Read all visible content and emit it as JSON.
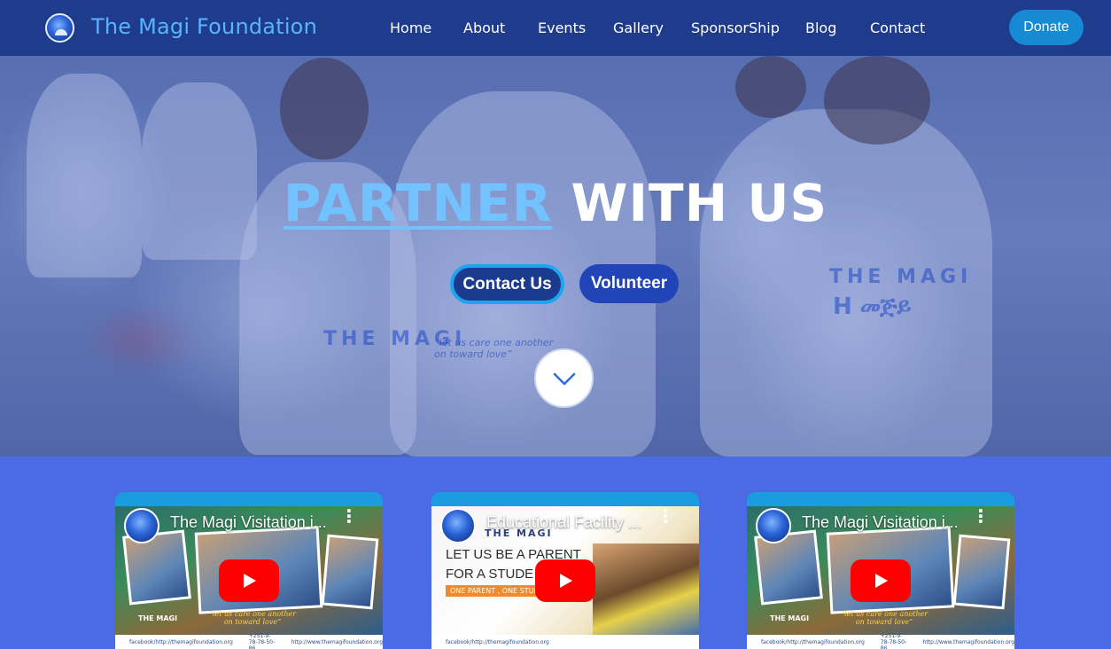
{
  "header": {
    "brand": "The Magi Foundation",
    "nav": [
      "Home",
      "About",
      "Events",
      "Gallery",
      "SponsorShip",
      "Blog",
      "Contact"
    ],
    "donate": "Donate"
  },
  "hero": {
    "title_accent": "PARTNER",
    "title_rest": "WITH US",
    "contact_button": "Contact Us",
    "volunteer_button": "Volunteer",
    "shirt_text_1": "THE MAGI",
    "shirt_text_2": "H መጅይ",
    "shirt_text_3": "“let us care one another on toward love”"
  },
  "videos": [
    {
      "title": "The Magi Visitation i...",
      "poster_logo": "THE MAGI",
      "caption": "“let us  care one another on toward love”"
    },
    {
      "title": "Educational Facility ...",
      "poster_logo": "THE MAGI",
      "line1": "LET US BE A PARENT",
      "line2": "FOR A STUDE",
      "tag": "ONE PARENT , ONE STUDENT"
    },
    {
      "title": "The Magi Visitation i...",
      "poster_logo": "THE MAGI",
      "caption": "“let us  care one another on toward love”"
    }
  ],
  "footer_strip": [
    "facebook/http://themagifoundation.org",
    "+251-9-78-78-50-86",
    "http://www.themagifoundation.org"
  ],
  "colors": {
    "navbar": "#1e3b8c",
    "brand": "#58b4ff",
    "accent": "#72c2ff",
    "donate": "#168bd4",
    "section": "#4a6be3",
    "youtube_red": "#ff0000"
  },
  "icons": {
    "logo": "magi-globe-logo",
    "scroll": "chevron-down-icon",
    "play": "youtube-play-icon",
    "menu": "more-vert-icon"
  }
}
